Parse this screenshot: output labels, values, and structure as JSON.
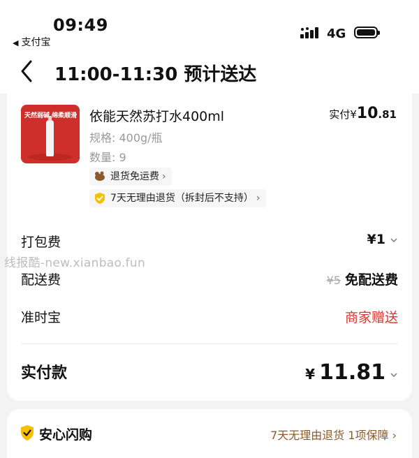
{
  "status_bar": {
    "time": "09:49",
    "back_app": "支付宝",
    "network": "4G"
  },
  "nav": {
    "title": "11:00-11:30 预计送达"
  },
  "product": {
    "thumb_text": "天然弱碱 绵柔顺滑",
    "name": "依能天然苏打水400ml",
    "spec": "规格: 400g/瓶",
    "quantity": "数量: 9",
    "paid_label": "实付",
    "paid_currency": "¥",
    "paid_int": "10",
    "paid_dec": ".81",
    "tag1": "退货免运费",
    "tag2": "7天无理由退货（拆封后不支持）"
  },
  "fees": {
    "packing_label": "打包费",
    "packing_value": "¥1",
    "shipping_label": "配送费",
    "shipping_original": "¥5",
    "shipping_value": "免配送费",
    "ontime_label": "准时宝",
    "ontime_value": "商家赠送"
  },
  "total": {
    "label": "实付款",
    "currency": "¥",
    "amount": "11.81"
  },
  "watermark": "线报酷-new.xianbao.fun",
  "assurance": {
    "title": "安心闪购",
    "guarantee": "7天无理由退货 1项保障 ›"
  },
  "colors": {
    "accent_red": "#e0322b",
    "shield_yellow": "#f5c000",
    "guarantee_brown": "#8a5a2b"
  }
}
